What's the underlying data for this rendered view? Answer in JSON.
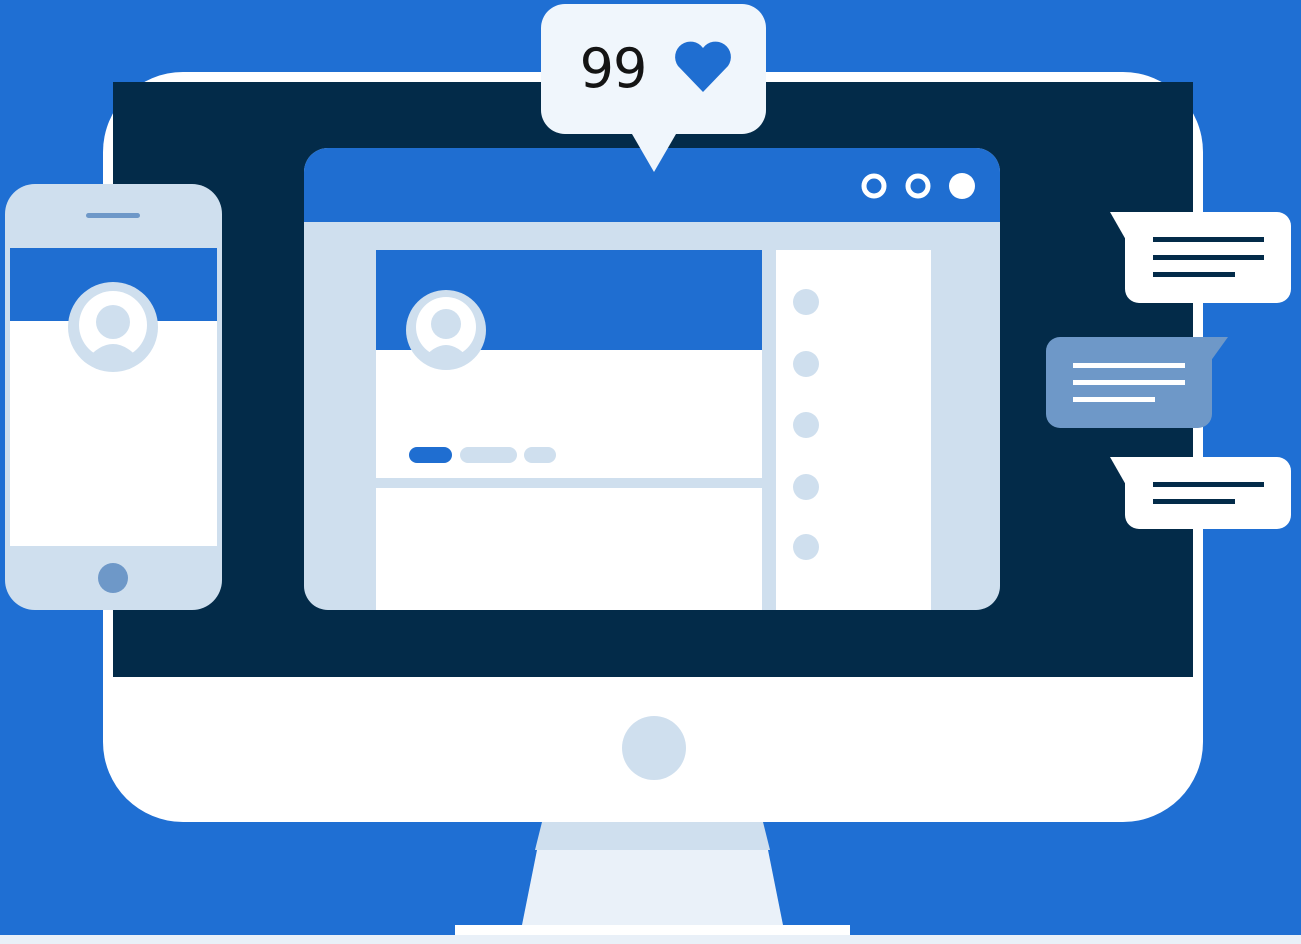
{
  "colors": {
    "background": "#1f6fd3",
    "screen_dark": "#032b49",
    "monitor_body": "#ffffff",
    "accent_blue": "#1f6ed1",
    "light_panel": "#cfdfee",
    "bubble_gray_blue": "#6e98c8",
    "text_dark": "#141414"
  },
  "notification": {
    "count": "99",
    "icon": "heart-icon"
  },
  "browser_window": {
    "controls": [
      "circle-outline-icon",
      "circle-outline-icon",
      "circle-filled-icon"
    ]
  },
  "icons": {
    "profile": "avatar-icon",
    "phone_home": "home-button-icon",
    "chat": "chat-bubble-icon"
  }
}
